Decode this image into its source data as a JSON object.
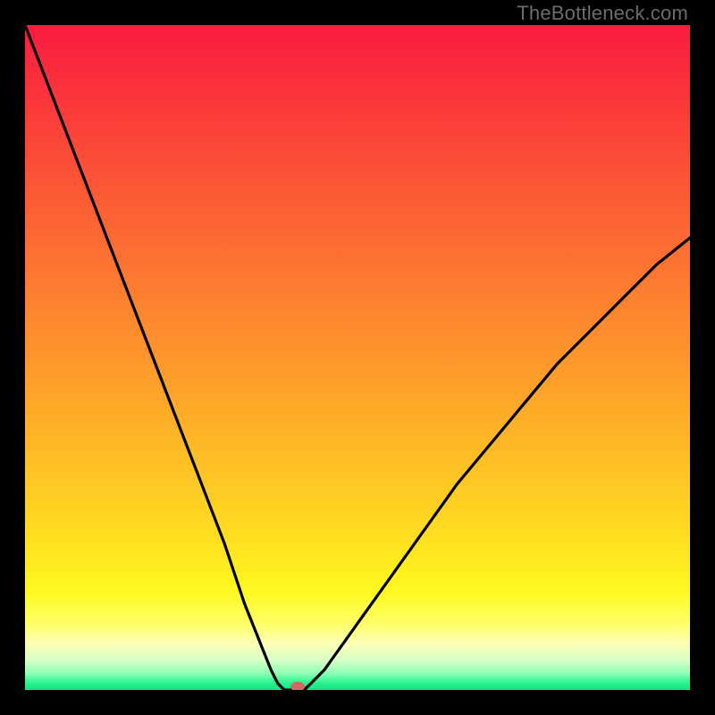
{
  "watermark": "TheBottleneck.com",
  "chart_data": {
    "type": "line",
    "title": "",
    "xlabel": "",
    "ylabel": "",
    "xlim": [
      0,
      100
    ],
    "ylim": [
      0,
      100
    ],
    "grid": false,
    "series": [
      {
        "name": "bottleneck-curve",
        "x": [
          0,
          5,
          10,
          15,
          20,
          25,
          30,
          33,
          35,
          37,
          38,
          39,
          40,
          42,
          45,
          50,
          55,
          60,
          65,
          70,
          75,
          80,
          85,
          90,
          95,
          100
        ],
        "y": [
          100,
          87,
          74,
          61,
          48,
          35,
          22,
          13,
          8,
          3,
          1,
          0,
          0,
          0,
          3,
          10,
          17,
          24,
          31,
          37,
          43,
          49,
          54,
          59,
          64,
          68
        ]
      }
    ],
    "marker": {
      "x": 41,
      "y": 0.5,
      "color": "#cf6a63"
    },
    "gradient_stops": [
      {
        "pos": 0.0,
        "color": "#fa1b3f"
      },
      {
        "pos": 0.13,
        "color": "#fb3b3a"
      },
      {
        "pos": 0.26,
        "color": "#fc5b35"
      },
      {
        "pos": 0.39,
        "color": "#fd7b30"
      },
      {
        "pos": 0.52,
        "color": "#fe9b2b"
      },
      {
        "pos": 0.64,
        "color": "#febb26"
      },
      {
        "pos": 0.76,
        "color": "#ffdb21"
      },
      {
        "pos": 0.85,
        "color": "#fff81e"
      },
      {
        "pos": 0.9,
        "color": "#ffff66"
      },
      {
        "pos": 0.93,
        "color": "#fcffb5"
      },
      {
        "pos": 0.955,
        "color": "#d9ffc7"
      },
      {
        "pos": 0.975,
        "color": "#8dffb3"
      },
      {
        "pos": 0.99,
        "color": "#27f38e"
      },
      {
        "pos": 1.0,
        "color": "#12e083"
      }
    ]
  }
}
